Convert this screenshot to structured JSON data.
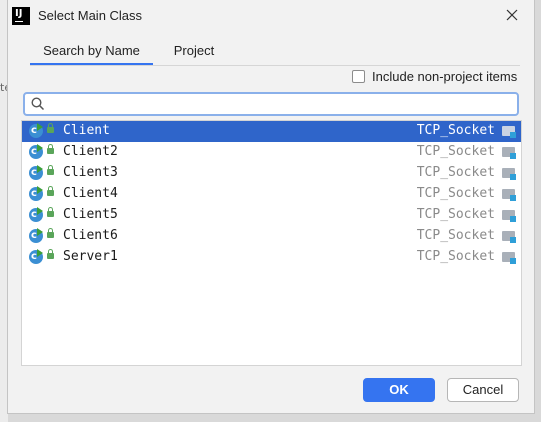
{
  "dialog": {
    "title": "Select Main Class",
    "app_icon_text": "IJ"
  },
  "tabs": [
    {
      "label": "Search by Name",
      "active": true
    },
    {
      "label": "Project",
      "active": false
    }
  ],
  "include_non_project": {
    "label": "Include non-project items",
    "checked": false
  },
  "search": {
    "value": "",
    "placeholder": ""
  },
  "classes": [
    {
      "name": "Client",
      "module": "TCP_Socket",
      "selected": true
    },
    {
      "name": "Client2",
      "module": "TCP_Socket",
      "selected": false
    },
    {
      "name": "Client3",
      "module": "TCP_Socket",
      "selected": false
    },
    {
      "name": "Client4",
      "module": "TCP_Socket",
      "selected": false
    },
    {
      "name": "Client5",
      "module": "TCP_Socket",
      "selected": false
    },
    {
      "name": "Client6",
      "module": "TCP_Socket",
      "selected": false
    },
    {
      "name": "Server1",
      "module": "TCP_Socket",
      "selected": false
    }
  ],
  "buttons": {
    "ok": "OK",
    "cancel": "Cancel"
  },
  "background_fragment": "te",
  "colors": {
    "accent": "#3574f0",
    "selection": "#2f65ca",
    "class_icon": "#3b8fd3"
  }
}
